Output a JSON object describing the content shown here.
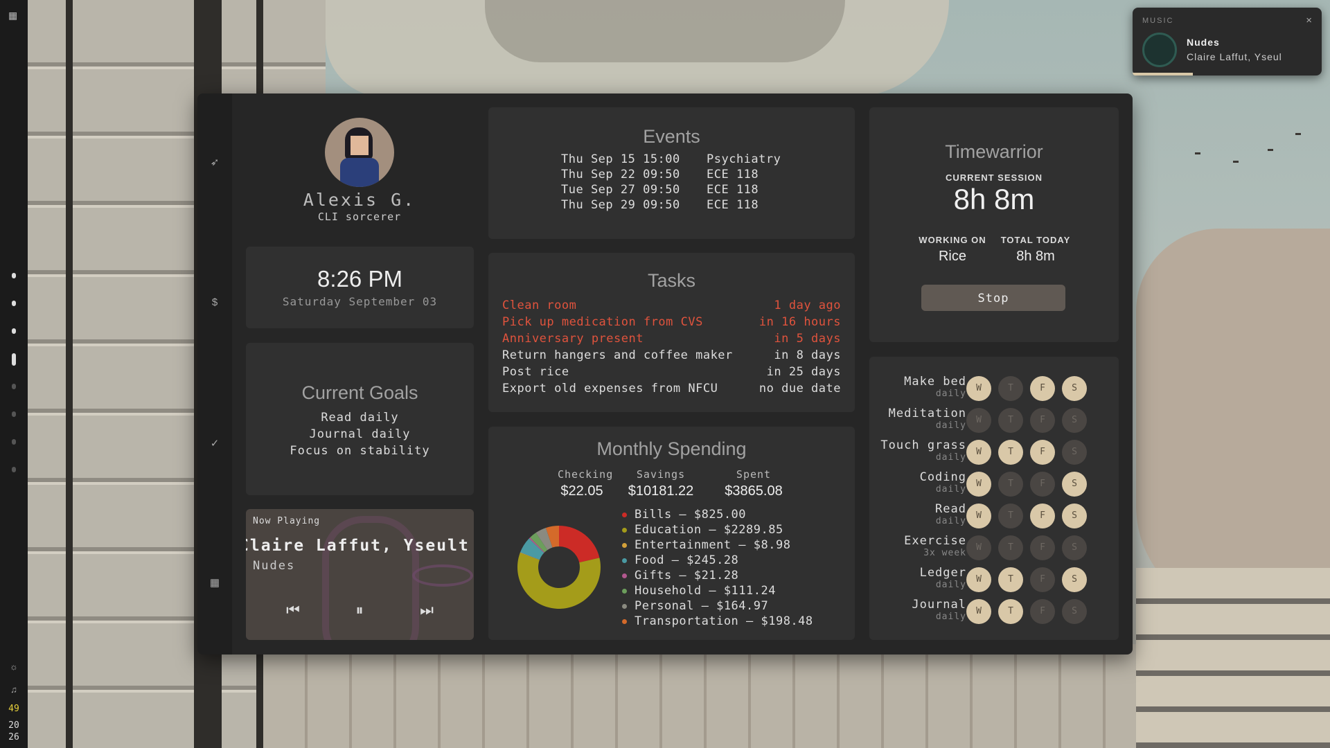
{
  "music_notification": {
    "label": "MUSIC",
    "title": "Nudes",
    "artist": "Claire Laffut, Yseul",
    "close_glyph": "×",
    "progress": 0.32
  },
  "system_bar": {
    "apps_icon": "grid-icon",
    "workspaces": [
      {
        "active": true
      },
      {
        "active": true
      },
      {
        "active": true
      },
      {
        "active": true
      },
      {
        "active": false
      },
      {
        "active": false
      },
      {
        "active": false
      },
      {
        "active": false
      }
    ],
    "brightness_icon": "sun-icon",
    "audio_icon": "headphones-icon",
    "battery": "49",
    "battery_color": "#e8d13c",
    "time_hour": "20",
    "time_minute": "26"
  },
  "sidebar": {
    "icons": [
      "rocket-icon",
      "dollar-icon",
      "check-circle-icon",
      "calendar-icon"
    ],
    "glyphs": [
      "➶",
      "$",
      "✓",
      "▦"
    ]
  },
  "profile": {
    "name": "Alexis G.",
    "role": "CLI sorcerer"
  },
  "clock": {
    "time": "8:26 PM",
    "date": "Saturday September 03"
  },
  "goals": {
    "title": "Current Goals",
    "items": [
      "Read daily",
      "Journal daily",
      "Focus on stability"
    ]
  },
  "now_playing": {
    "label": "Now Playing",
    "artist": "Claire Laffut, Yseult",
    "title": "Nudes",
    "prev_glyph": "⏮",
    "pause_glyph": "⏸",
    "next_glyph": "⏭"
  },
  "events": {
    "title": "Events",
    "items": [
      {
        "date": "Thu Sep 15 15:00",
        "name": "Psychiatry"
      },
      {
        "date": "Thu Sep 22 09:50",
        "name": "ECE 118"
      },
      {
        "date": "Tue Sep 27 09:50",
        "name": "ECE 118"
      },
      {
        "date": "Thu Sep 29 09:50",
        "name": "ECE 118"
      }
    ]
  },
  "tasks": {
    "title": "Tasks",
    "items": [
      {
        "name": "Clean room",
        "due": "1 day ago",
        "overdue": true
      },
      {
        "name": "Pick up medication from CVS",
        "due": "in 16 hours",
        "overdue": true
      },
      {
        "name": "Anniversary present",
        "due": "in 5 days",
        "overdue": true
      },
      {
        "name": "Return hangers and coffee maker",
        "due": "in 8 days",
        "overdue": false
      },
      {
        "name": "Post rice",
        "due": "in 25 days",
        "overdue": false
      },
      {
        "name": "Export old expenses from NFCU",
        "due": "no due date",
        "overdue": false
      }
    ]
  },
  "spending": {
    "title": "Monthly Spending",
    "accounts": [
      {
        "label": "Checking",
        "value": "$22.05"
      },
      {
        "label": "Savings",
        "value": "$10181.22"
      },
      {
        "label": "Spent",
        "value": "$3865.08"
      }
    ],
    "categories": [
      {
        "text": "Bills – $825.00",
        "amount": 825.0,
        "color": "#cc2b26"
      },
      {
        "text": "Education – $2289.85",
        "amount": 2289.85,
        "color": "#a49c1a"
      },
      {
        "text": "Entertainment – $8.98",
        "amount": 8.98,
        "color": "#d4a13a"
      },
      {
        "text": "Food – $245.28",
        "amount": 245.28,
        "color": "#4a9aa3"
      },
      {
        "text": "Gifts – $21.28",
        "amount": 21.28,
        "color": "#b3588f"
      },
      {
        "text": "Household – $111.24",
        "amount": 111.24,
        "color": "#6c9e5c"
      },
      {
        "text": "Personal – $164.97",
        "amount": 164.97,
        "color": "#8a8a80"
      },
      {
        "text": "Transportation – $198.48",
        "amount": 198.48,
        "color": "#d46a2a"
      }
    ]
  },
  "timewarrior": {
    "title": "Timewarrior",
    "session_label": "CURRENT SESSION",
    "session_value": "8h 8m",
    "working_label": "WORKING ON",
    "working_value": "Rice",
    "total_label": "TOTAL TODAY",
    "total_value": "8h 8m",
    "stop_label": "Stop"
  },
  "habits": {
    "day_labels": [
      "W",
      "T",
      "F",
      "S"
    ],
    "items": [
      {
        "name": "Make bed",
        "freq": "daily",
        "days": [
          true,
          false,
          true,
          true
        ]
      },
      {
        "name": "Meditation",
        "freq": "daily",
        "days": [
          false,
          false,
          false,
          false
        ]
      },
      {
        "name": "Touch grass",
        "freq": "daily",
        "days": [
          true,
          true,
          true,
          false
        ]
      },
      {
        "name": "Coding",
        "freq": "daily",
        "days": [
          true,
          false,
          false,
          true
        ]
      },
      {
        "name": "Read",
        "freq": "daily",
        "days": [
          true,
          false,
          true,
          true
        ]
      },
      {
        "name": "Exercise",
        "freq": "3x week",
        "days": [
          false,
          false,
          false,
          false
        ]
      },
      {
        "name": "Ledger",
        "freq": "daily",
        "days": [
          true,
          true,
          false,
          true
        ]
      },
      {
        "name": "Journal",
        "freq": "daily",
        "days": [
          true,
          true,
          false,
          false
        ]
      }
    ]
  }
}
